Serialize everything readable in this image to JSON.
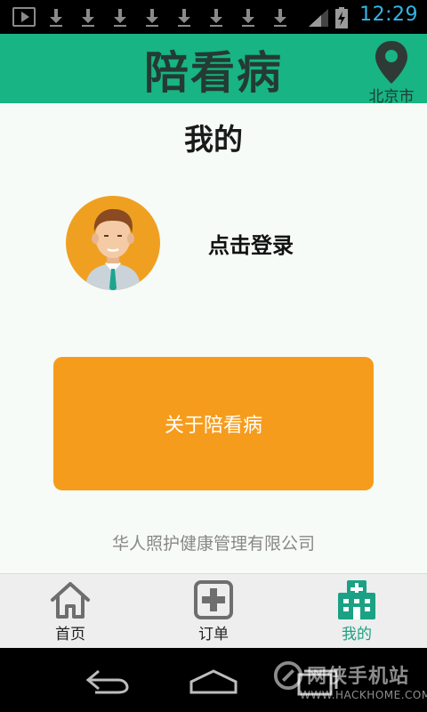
{
  "status_bar": {
    "time": "12:29"
  },
  "header": {
    "title": "陪看病",
    "location": "北京市"
  },
  "page": {
    "title": "我的"
  },
  "profile": {
    "login_text": "点击登录"
  },
  "about": {
    "label": "关于陪看病"
  },
  "footer": {
    "company": "华人照护健康管理有限公司"
  },
  "nav": {
    "items": [
      {
        "label": "首页",
        "icon": "home-icon"
      },
      {
        "label": "订单",
        "icon": "plus-box-icon"
      },
      {
        "label": "我的",
        "icon": "hospital-icon",
        "active": true
      }
    ]
  },
  "watermark": {
    "text": "网侠手机站",
    "url": "WWW.HACKHOME.COM"
  },
  "colors": {
    "header": "#18b483",
    "accent": "#1ba183",
    "button": "#f69c1c",
    "time": "#33b5e5"
  }
}
